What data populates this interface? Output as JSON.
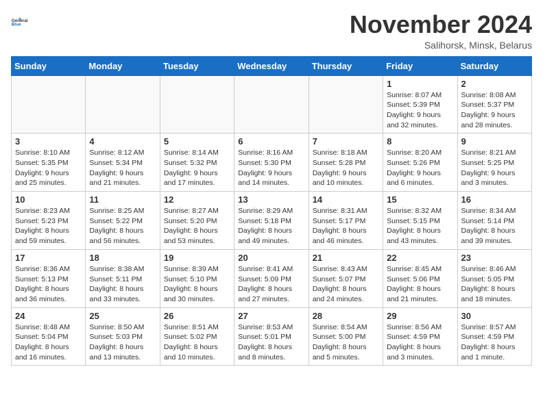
{
  "header": {
    "logo_line1": "General",
    "logo_line2": "Blue",
    "month_title": "November 2024",
    "subtitle": "Salihorsk, Minsk, Belarus"
  },
  "days_of_week": [
    "Sunday",
    "Monday",
    "Tuesday",
    "Wednesday",
    "Thursday",
    "Friday",
    "Saturday"
  ],
  "weeks": [
    [
      {
        "day": "",
        "info": ""
      },
      {
        "day": "",
        "info": ""
      },
      {
        "day": "",
        "info": ""
      },
      {
        "day": "",
        "info": ""
      },
      {
        "day": "",
        "info": ""
      },
      {
        "day": "1",
        "info": "Sunrise: 8:07 AM\nSunset: 5:39 PM\nDaylight: 9 hours\nand 32 minutes."
      },
      {
        "day": "2",
        "info": "Sunrise: 8:08 AM\nSunset: 5:37 PM\nDaylight: 9 hours\nand 28 minutes."
      }
    ],
    [
      {
        "day": "3",
        "info": "Sunrise: 8:10 AM\nSunset: 5:35 PM\nDaylight: 9 hours\nand 25 minutes."
      },
      {
        "day": "4",
        "info": "Sunrise: 8:12 AM\nSunset: 5:34 PM\nDaylight: 9 hours\nand 21 minutes."
      },
      {
        "day": "5",
        "info": "Sunrise: 8:14 AM\nSunset: 5:32 PM\nDaylight: 9 hours\nand 17 minutes."
      },
      {
        "day": "6",
        "info": "Sunrise: 8:16 AM\nSunset: 5:30 PM\nDaylight: 9 hours\nand 14 minutes."
      },
      {
        "day": "7",
        "info": "Sunrise: 8:18 AM\nSunset: 5:28 PM\nDaylight: 9 hours\nand 10 minutes."
      },
      {
        "day": "8",
        "info": "Sunrise: 8:20 AM\nSunset: 5:26 PM\nDaylight: 9 hours\nand 6 minutes."
      },
      {
        "day": "9",
        "info": "Sunrise: 8:21 AM\nSunset: 5:25 PM\nDaylight: 9 hours\nand 3 minutes."
      }
    ],
    [
      {
        "day": "10",
        "info": "Sunrise: 8:23 AM\nSunset: 5:23 PM\nDaylight: 8 hours\nand 59 minutes."
      },
      {
        "day": "11",
        "info": "Sunrise: 8:25 AM\nSunset: 5:22 PM\nDaylight: 8 hours\nand 56 minutes."
      },
      {
        "day": "12",
        "info": "Sunrise: 8:27 AM\nSunset: 5:20 PM\nDaylight: 8 hours\nand 53 minutes."
      },
      {
        "day": "13",
        "info": "Sunrise: 8:29 AM\nSunset: 5:18 PM\nDaylight: 8 hours\nand 49 minutes."
      },
      {
        "day": "14",
        "info": "Sunrise: 8:31 AM\nSunset: 5:17 PM\nDaylight: 8 hours\nand 46 minutes."
      },
      {
        "day": "15",
        "info": "Sunrise: 8:32 AM\nSunset: 5:15 PM\nDaylight: 8 hours\nand 43 minutes."
      },
      {
        "day": "16",
        "info": "Sunrise: 8:34 AM\nSunset: 5:14 PM\nDaylight: 8 hours\nand 39 minutes."
      }
    ],
    [
      {
        "day": "17",
        "info": "Sunrise: 8:36 AM\nSunset: 5:13 PM\nDaylight: 8 hours\nand 36 minutes."
      },
      {
        "day": "18",
        "info": "Sunrise: 8:38 AM\nSunset: 5:11 PM\nDaylight: 8 hours\nand 33 minutes."
      },
      {
        "day": "19",
        "info": "Sunrise: 8:39 AM\nSunset: 5:10 PM\nDaylight: 8 hours\nand 30 minutes."
      },
      {
        "day": "20",
        "info": "Sunrise: 8:41 AM\nSunset: 5:09 PM\nDaylight: 8 hours\nand 27 minutes."
      },
      {
        "day": "21",
        "info": "Sunrise: 8:43 AM\nSunset: 5:07 PM\nDaylight: 8 hours\nand 24 minutes."
      },
      {
        "day": "22",
        "info": "Sunrise: 8:45 AM\nSunset: 5:06 PM\nDaylight: 8 hours\nand 21 minutes."
      },
      {
        "day": "23",
        "info": "Sunrise: 8:46 AM\nSunset: 5:05 PM\nDaylight: 8 hours\nand 18 minutes."
      }
    ],
    [
      {
        "day": "24",
        "info": "Sunrise: 8:48 AM\nSunset: 5:04 PM\nDaylight: 8 hours\nand 16 minutes."
      },
      {
        "day": "25",
        "info": "Sunrise: 8:50 AM\nSunset: 5:03 PM\nDaylight: 8 hours\nand 13 minutes."
      },
      {
        "day": "26",
        "info": "Sunrise: 8:51 AM\nSunset: 5:02 PM\nDaylight: 8 hours\nand 10 minutes."
      },
      {
        "day": "27",
        "info": "Sunrise: 8:53 AM\nSunset: 5:01 PM\nDaylight: 8 hours\nand 8 minutes."
      },
      {
        "day": "28",
        "info": "Sunrise: 8:54 AM\nSunset: 5:00 PM\nDaylight: 8 hours\nand 5 minutes."
      },
      {
        "day": "29",
        "info": "Sunrise: 8:56 AM\nSunset: 4:59 PM\nDaylight: 8 hours\nand 3 minutes."
      },
      {
        "day": "30",
        "info": "Sunrise: 8:57 AM\nSunset: 4:59 PM\nDaylight: 8 hours\nand 1 minute."
      }
    ]
  ]
}
